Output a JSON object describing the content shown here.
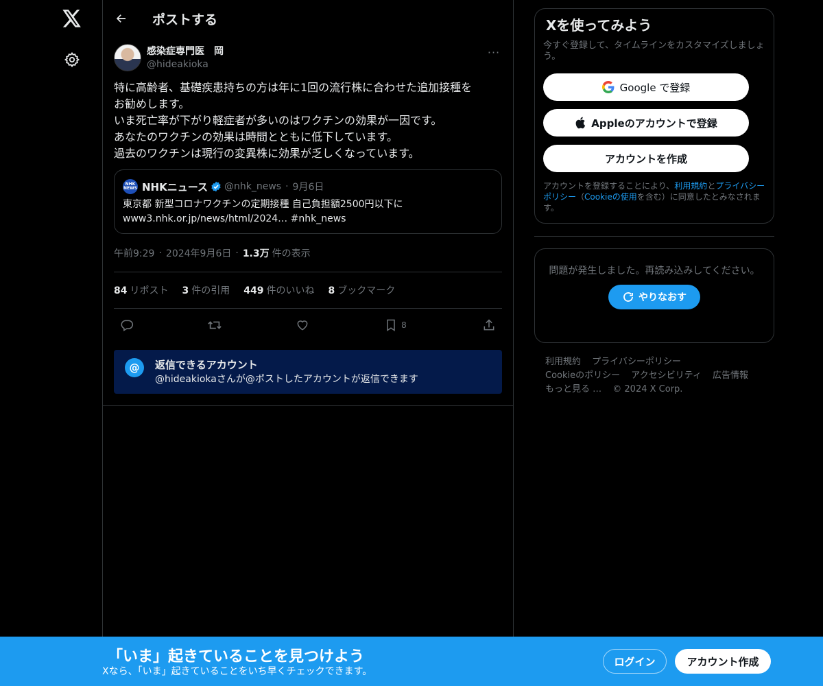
{
  "header": {
    "title": "ポストする"
  },
  "post": {
    "author_name": "感染症専門医　岡",
    "author_handle": "@hideakioka",
    "more_label": "···",
    "text": "特に高齢者、基礎疾患持ちの方は年に1回の流行株に合わせた追加接種を\nお勧めします。\nいま死亡率が下がり軽症者が多いのはワクチンの効果が一因です。\nあなたのワクチンの効果は時間とともに低下しています。\n過去のワクチンは現行の変異株に効果が乏しくなっています。",
    "quote": {
      "logo_text": "NHK NEWS",
      "name": "NHKニュース",
      "handle": "@nhk_news",
      "dot": "·",
      "date": "9月6日",
      "text_line1": "東京都 新型コロナワクチンの定期接種 自己負担額2500円以下に",
      "text_line2": "www3.nhk.or.jp/news/html/2024… #nhk_news"
    },
    "meta": {
      "time": "午前9:29",
      "sep": "·",
      "date": "2024年9月6日",
      "views_count": "1.3万",
      "views_label": "件の表示"
    },
    "stats": [
      {
        "count": "84",
        "label": "リポスト"
      },
      {
        "count": "3",
        "label": "件の引用"
      },
      {
        "count": "449",
        "label": "件のいいね"
      },
      {
        "count": "8",
        "label": "ブックマーク"
      }
    ],
    "bookmark_count": "8",
    "reply_restriction": {
      "icon": "@",
      "title": "返信できるアカウント",
      "desc": "@hideakiokaさんが@ポストしたアカウントが返信できます"
    }
  },
  "sidebar": {
    "title": "Xを使ってみよう",
    "subtitle": "今すぐ登録して、タイムラインをカスタマイズしましょう。",
    "google_label": "Google で登録",
    "apple_label": "Appleのアカウントで登録",
    "create_label": "アカウントを作成",
    "terms_prefix": "アカウントを登録することにより、",
    "terms_link": "利用規約",
    "terms_and": "と",
    "privacy_link": "プライバシーポリシー",
    "terms_open": "（",
    "cookie_link": "Cookieの使用",
    "terms_suffix": "を含む）に同意したとみなされます。",
    "error_text": "問題が発生しました。再読み込みしてください。",
    "retry_label": "やりなおす",
    "footer": {
      "terms": "利用規約",
      "privacy": "プライバシーポリシー",
      "cookie": "Cookieのポリシー",
      "accessibility": "アクセシビリティ",
      "ads": "広告情報",
      "more": "もっと見る …",
      "copyright": "© 2024 X Corp."
    }
  },
  "bottom_bar": {
    "title": "「いま」起きていることを見つけよう",
    "subtitle": "Xなら、「いま」起きていることをいち早くチェックできます。",
    "login": "ログイン",
    "signup": "アカウント作成"
  },
  "colors": {
    "accent": "#1d9bf0",
    "reply_box": "#041a4a"
  }
}
